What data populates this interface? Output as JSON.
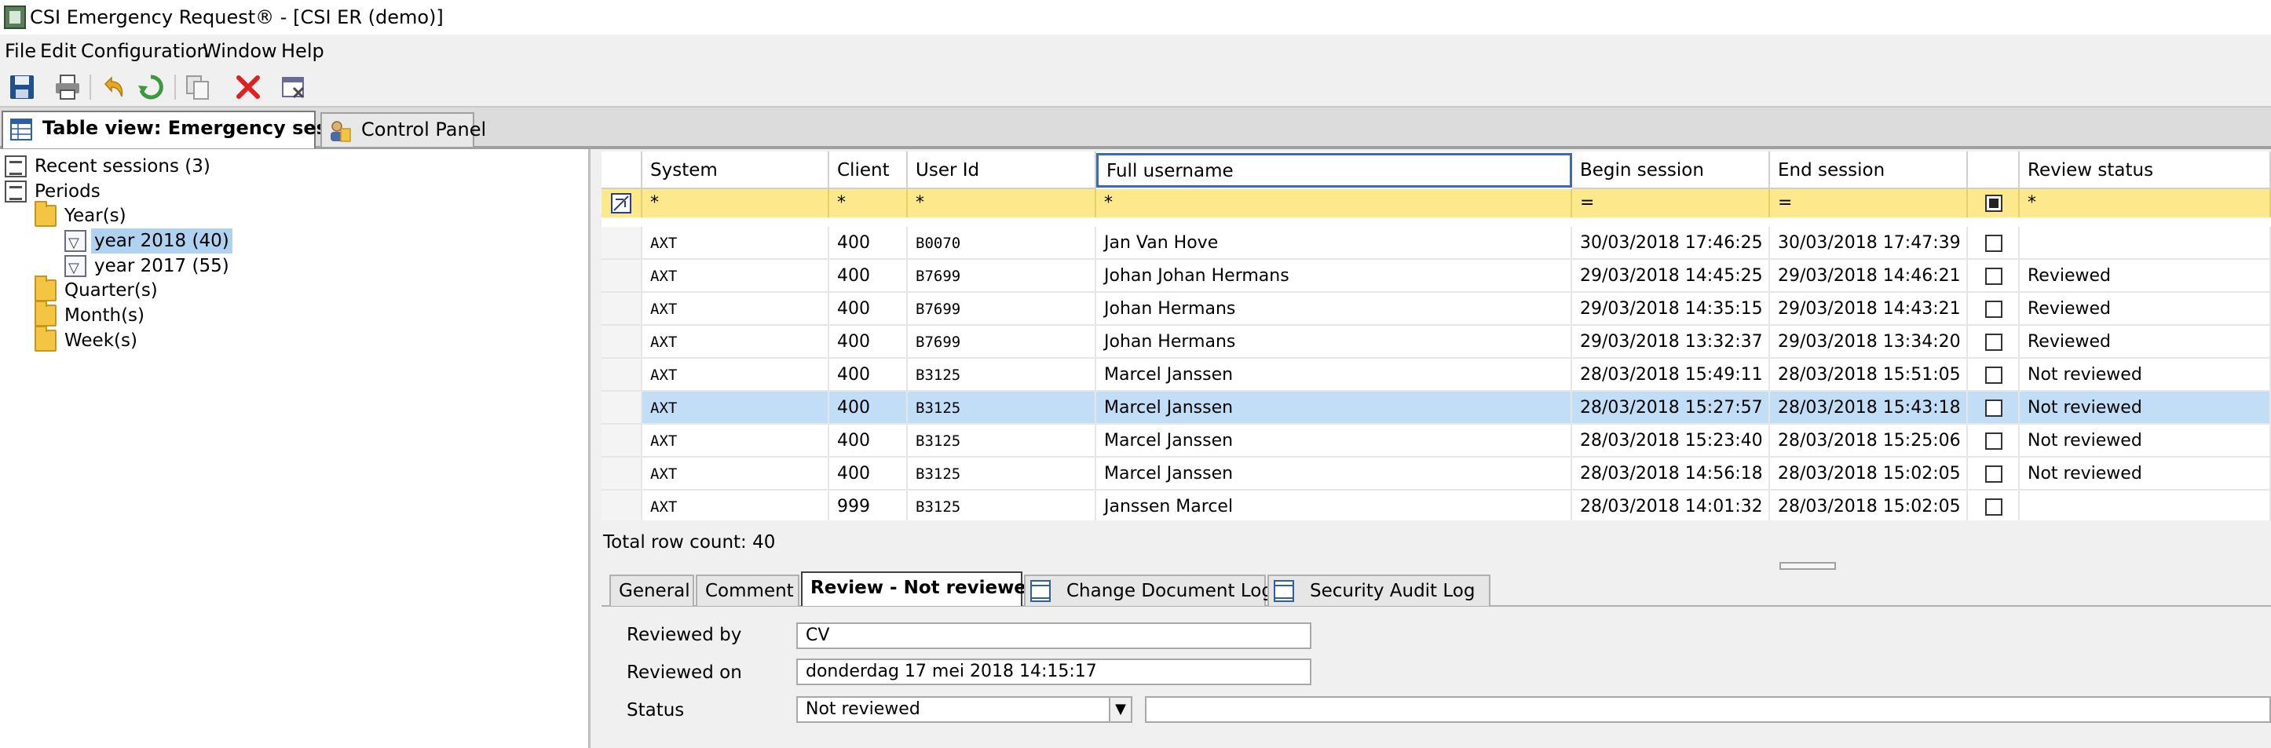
{
  "window": {
    "title": "CSI Emergency Request® - [CSI ER (demo)]"
  },
  "menu": [
    "File",
    "Edit",
    "Configuration",
    "Window",
    "Help"
  ],
  "toolbar": [
    "save-icon",
    "print-icon",
    "undo-icon",
    "refresh-icon",
    "copy-icon",
    "delete-icon",
    "close-window-icon"
  ],
  "main_tabs": [
    {
      "label": "Table view: Emergency sessions",
      "active": true
    },
    {
      "label": "Control Panel",
      "active": false
    }
  ],
  "tree": {
    "recent": "Recent sessions (3)",
    "periods": "Periods",
    "years": "Year(s)",
    "year2018": "year 2018 (40)",
    "year2017": "year 2017 (55)",
    "quarters": "Quarter(s)",
    "months": "Month(s)",
    "weeks": "Week(s)"
  },
  "grid": {
    "columns": [
      "System",
      "Client",
      "User Id",
      "Full username",
      "Begin session",
      "End session",
      "",
      "Review status"
    ],
    "filters": [
      "*",
      "*",
      "*",
      "*",
      "=",
      "=",
      "",
      "*"
    ],
    "rows": [
      [
        "AXT",
        "400",
        "B0070",
        "Jan Van Hove",
        "30/03/2018 17:46:25",
        "30/03/2018 17:47:39",
        "",
        ""
      ],
      [
        "AXT",
        "400",
        "B7699",
        "Johan Johan Hermans",
        "29/03/2018 14:45:25",
        "29/03/2018 14:46:21",
        "",
        "Reviewed"
      ],
      [
        "AXT",
        "400",
        "B7699",
        "Johan Hermans",
        "29/03/2018 14:35:15",
        "29/03/2018 14:43:21",
        "",
        "Reviewed"
      ],
      [
        "AXT",
        "400",
        "B7699",
        "Johan Hermans",
        "29/03/2018 13:32:37",
        "29/03/2018 13:34:20",
        "",
        "Reviewed"
      ],
      [
        "AXT",
        "400",
        "B3125",
        "Marcel Janssen",
        "28/03/2018 15:49:11",
        "28/03/2018 15:51:05",
        "",
        "Not reviewed"
      ],
      [
        "AXT",
        "400",
        "B3125",
        "Marcel Janssen",
        "28/03/2018 15:27:57",
        "28/03/2018 15:43:18",
        "",
        "Not reviewed"
      ],
      [
        "AXT",
        "400",
        "B3125",
        "Marcel Janssen",
        "28/03/2018 15:23:40",
        "28/03/2018 15:25:06",
        "",
        "Not reviewed"
      ],
      [
        "AXT",
        "400",
        "B3125",
        "Marcel Janssen",
        "28/03/2018 14:56:18",
        "28/03/2018 15:02:05",
        "",
        "Not reviewed"
      ],
      [
        "AXT",
        "999",
        "B3125",
        "Janssen Marcel",
        "28/03/2018 14:01:32",
        "28/03/2018 15:02:05",
        "",
        ""
      ]
    ],
    "selected_row": 5,
    "row_count": "Total row count: 40"
  },
  "detail_tabs": [
    "General",
    "Comment",
    "Review - Not reviewed",
    "Change Document Log",
    "Security Audit Log"
  ],
  "detail_active": 2,
  "review": {
    "reviewed_by_label": "Reviewed by",
    "reviewed_by": "CV",
    "reviewed_on_label": "Reviewed on",
    "reviewed_on": "donderdag 17 mei 2018 14:15:17",
    "status_label": "Status",
    "status": "Not reviewed",
    "status_note": ""
  }
}
